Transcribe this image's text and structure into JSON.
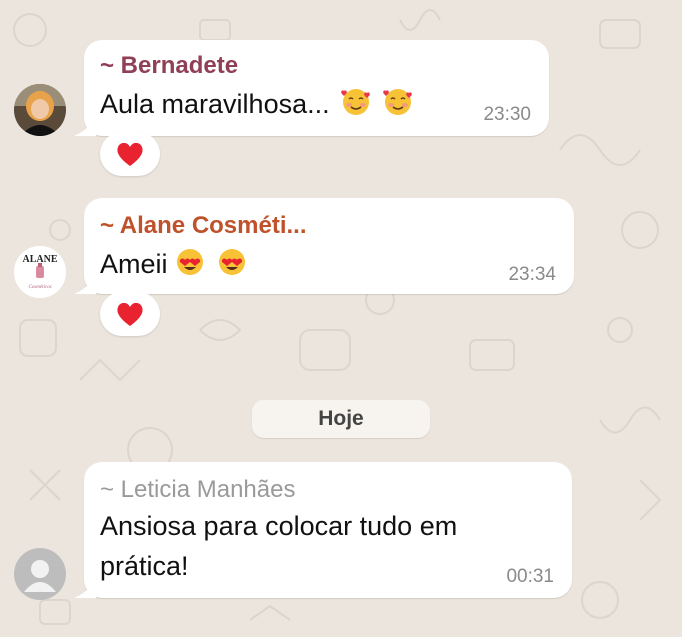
{
  "day_separator": "Hoje",
  "messages": [
    {
      "sender": "~ Bernadete",
      "sender_color": "#8f3f56",
      "text": "Aula maravilhosa...",
      "emojis": [
        "smiling-face-with-hearts-icon",
        "smiling-face-with-hearts-icon"
      ],
      "time": "23:30",
      "reaction": "red-heart-icon"
    },
    {
      "sender": "~ Alane Cosméti...",
      "sender_color": "#c0522b",
      "avatar_text": "ALANE",
      "avatar_subtext": "Cosméticos",
      "text": "Ameii",
      "emojis": [
        "heart-eyes-icon",
        "heart-eyes-icon"
      ],
      "time": "23:34",
      "reaction": "red-heart-icon"
    },
    {
      "sender": "~ Leticia Manhães",
      "sender_color": "#9a9a9a",
      "text_line1": "Ansiosa para colocar tudo em",
      "text_line2": "prática!",
      "time": "00:31"
    }
  ]
}
